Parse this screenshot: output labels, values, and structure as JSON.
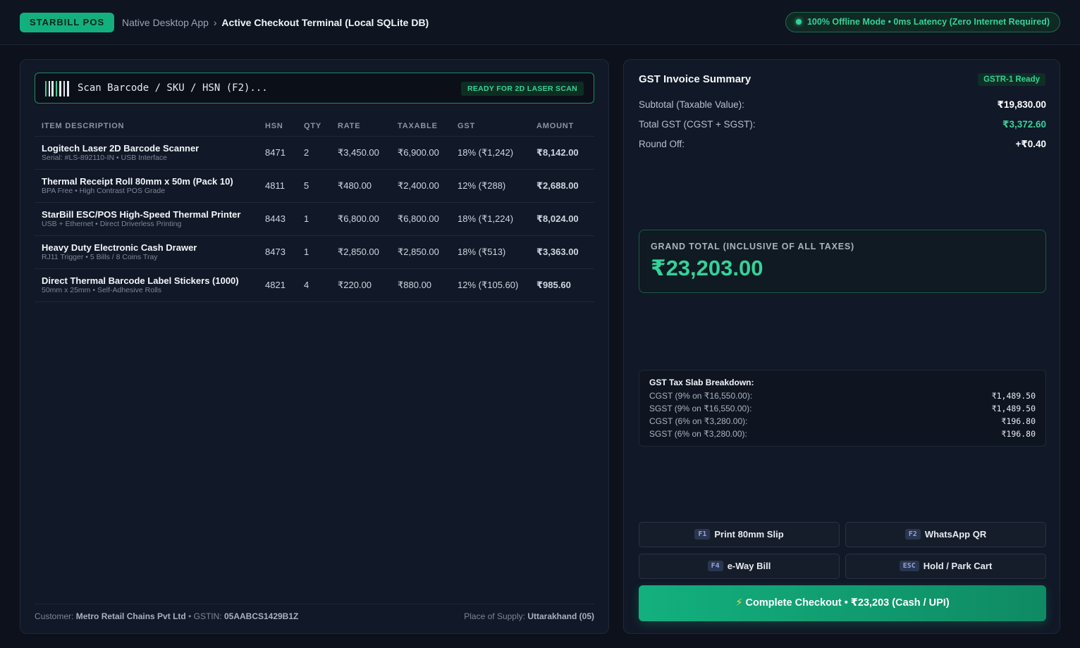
{
  "header": {
    "brand": "STARBILL POS",
    "breadcrumb_parent": "Native Desktop App",
    "breadcrumb_sep": "›",
    "breadcrumb_current": "Active Checkout Terminal (Local SQLite DB)",
    "status": "100% Offline Mode • 0ms Latency (Zero Internet Required)",
    "status_color": "#34d399"
  },
  "scan": {
    "icon": "barcode-icon",
    "placeholder": "Scan Barcode / SKU / HSN (F2)...",
    "badge": "READY FOR 2D LASER SCAN"
  },
  "table": {
    "headers": [
      "ITEM DESCRIPTION",
      "HSN",
      "QTY",
      "RATE",
      "TAXABLE",
      "GST",
      "AMOUNT"
    ],
    "rows": [
      {
        "name": "Logitech Laser 2D Barcode Scanner",
        "sub": "Serial: #LS-892110-IN • USB Interface",
        "hsn": "8471",
        "qty": "2",
        "rate": "₹3,450.00",
        "taxable": "₹6,900.00",
        "gst": "18% (₹1,242)",
        "amount": "₹8,142.00"
      },
      {
        "name": "Thermal Receipt Roll 80mm x 50m (Pack 10)",
        "sub": "BPA Free • High Contrast POS Grade",
        "hsn": "4811",
        "qty": "5",
        "rate": "₹480.00",
        "taxable": "₹2,400.00",
        "gst": "12% (₹288)",
        "amount": "₹2,688.00"
      },
      {
        "name": "StarBill ESC/POS High-Speed Thermal Printer",
        "sub": "USB + Ethernet • Direct Driverless Printing",
        "hsn": "8443",
        "qty": "1",
        "rate": "₹6,800.00",
        "taxable": "₹6,800.00",
        "gst": "18% (₹1,224)",
        "amount": "₹8,024.00"
      },
      {
        "name": "Heavy Duty Electronic Cash Drawer",
        "sub": "RJ11 Trigger • 5 Bills / 8 Coins Tray",
        "hsn": "8473",
        "qty": "1",
        "rate": "₹2,850.00",
        "taxable": "₹2,850.00",
        "gst": "18% (₹513)",
        "amount": "₹3,363.00"
      },
      {
        "name": "Direct Thermal Barcode Label Stickers (1000)",
        "sub": "50mm x 25mm • Self-Adhesive Rolls",
        "hsn": "4821",
        "qty": "4",
        "rate": "₹220.00",
        "taxable": "₹880.00",
        "gst": "12% (₹105.60)",
        "amount": "₹985.60"
      }
    ]
  },
  "footer": {
    "customer_label": "Customer:",
    "customer_name": "Metro Retail Chains Pvt Ltd",
    "gstin_label": "• GSTIN:",
    "gstin": "05AABCS1429B1Z",
    "supply_label": "Place of Supply:",
    "supply": "Uttarakhand (05)"
  },
  "summary": {
    "title": "GST Invoice Summary",
    "badge": "GSTR-1 Ready",
    "subtotal_label": "Subtotal (Taxable Value):",
    "subtotal": "₹19,830.00",
    "gst_label": "Total GST (CGST + SGST):",
    "gst": "₹3,372.60",
    "roundoff_label": "Round Off:",
    "roundoff": "+₹0.40",
    "grand_label": "GRAND TOTAL (INCLUSIVE OF ALL TAXES)",
    "grand": "₹23,203.00"
  },
  "slab": {
    "title": "GST Tax Slab Breakdown:",
    "rows": [
      {
        "label": "CGST (9% on ₹16,550.00):",
        "value": "₹1,489.50"
      },
      {
        "label": "SGST (9% on ₹16,550.00):",
        "value": "₹1,489.50"
      },
      {
        "label": "CGST (6% on ₹3,280.00):",
        "value": "₹196.80"
      },
      {
        "label": "SGST (6% on ₹3,280.00):",
        "value": "₹196.80"
      }
    ]
  },
  "actions": {
    "print_key": "F1",
    "print": "Print 80mm Slip",
    "whatsapp_key": "F2",
    "whatsapp": "WhatsApp QR",
    "eway_key": "F4",
    "eway": "e-Way Bill",
    "hold_key": "ESC",
    "hold": "Hold / Park Cart",
    "checkout_icon": "⚡",
    "checkout": "Complete Checkout • ₹23,203 (Cash / UPI)"
  },
  "colors": {
    "accent": "#13b07e",
    "green_text": "#34d399",
    "background": "#0c111c",
    "panel": "#111827"
  }
}
